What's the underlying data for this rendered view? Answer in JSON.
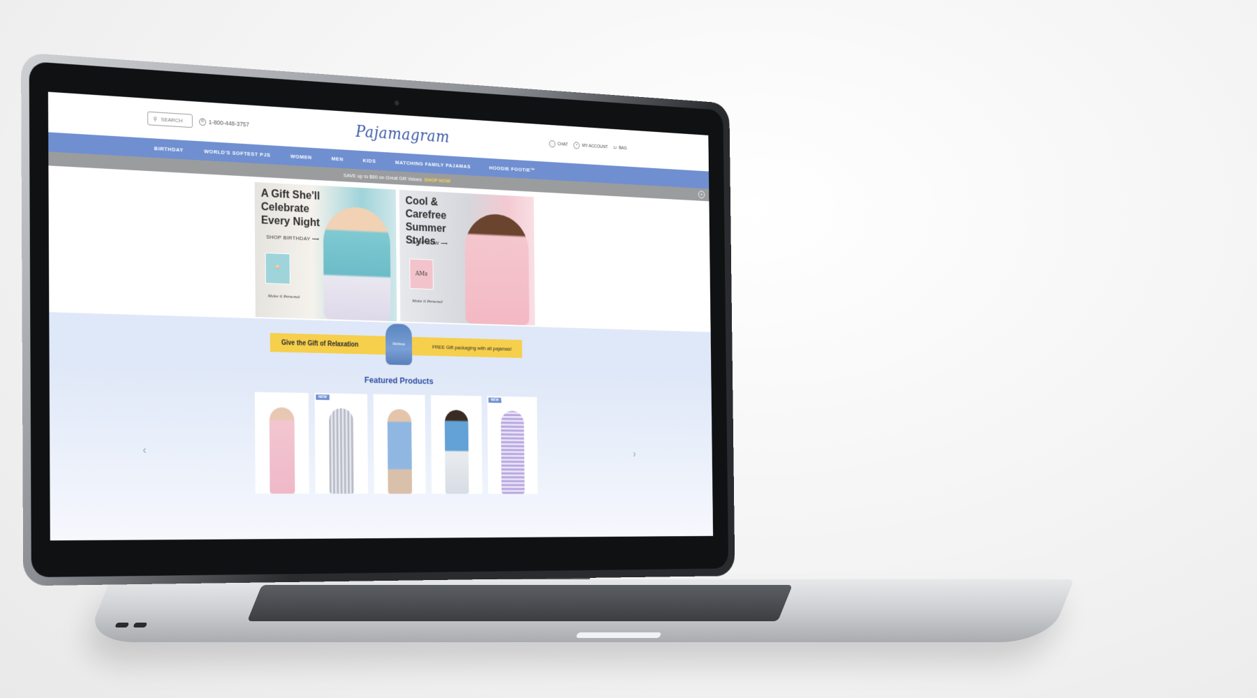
{
  "header": {
    "search_placeholder": "SEARCH",
    "phone": "1-800-448-3757",
    "logo": "Pajamagram",
    "chat": "CHAT",
    "account": "MY ACCOUNT",
    "bag": "BAG"
  },
  "nav": {
    "items": [
      "BIRTHDAY",
      "WORLD'S SOFTEST PJS",
      "WOMEN",
      "MEN",
      "KIDS",
      "MATCHING FAMILY PAJAMAS",
      "HOODIE FOOTIE™"
    ]
  },
  "promo": {
    "text": "SAVE up to $60 on Great Gift Values",
    "link": "SHOP NOW",
    "close": "×"
  },
  "hero": {
    "left": {
      "title": "A Gift She'll Celebrate Every Night",
      "cta": "SHOP BIRTHDAY ⟶",
      "tag": "🧁",
      "personal": "Make it Personal"
    },
    "right": {
      "title": "Cool & Carefree Summer Styles",
      "cta": "SHOP NOW ⟶",
      "tag": "AMs",
      "personal": "Make it Personal"
    }
  },
  "gift": {
    "left": "Give the Gift of Relaxation",
    "right": "FREE Gift packaging with all pajamas!",
    "bag_label": "Melissa"
  },
  "featured": {
    "title": "Featured Products",
    "products": [
      {
        "badge": ""
      },
      {
        "badge": "NEW"
      },
      {
        "badge": ""
      },
      {
        "badge": ""
      },
      {
        "badge": "NEW"
      }
    ],
    "arrow_left": "‹",
    "arrow_right": "›"
  }
}
